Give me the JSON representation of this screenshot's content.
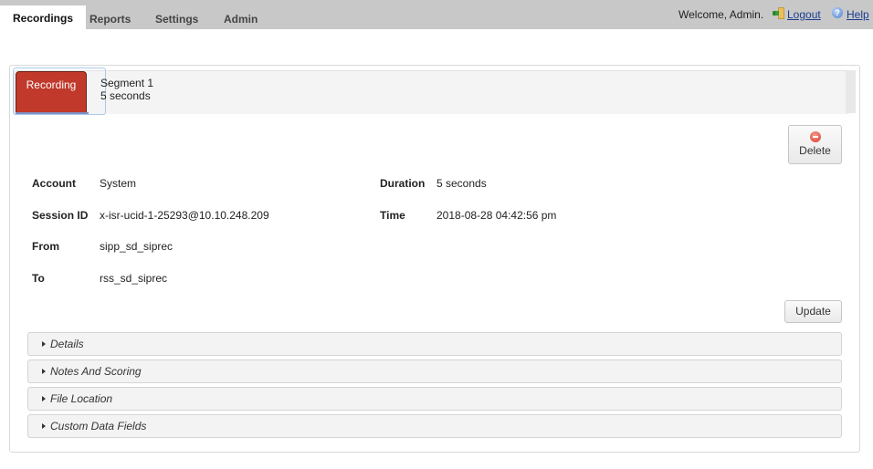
{
  "nav": {
    "tabs": [
      {
        "label": "Recordings",
        "active": true
      },
      {
        "label": "Reports",
        "active": false
      },
      {
        "label": "Settings",
        "active": false
      },
      {
        "label": "Admin",
        "active": false
      }
    ],
    "welcome": "Welcome, Admin.",
    "logout": "Logout",
    "help": "Help",
    "help_glyph": "?"
  },
  "recording": {
    "tabs": {
      "recording_label": "Recording",
      "segment_title": "Segment 1",
      "segment_duration": "5 seconds"
    },
    "delete_label": "Delete",
    "update_label": "Update",
    "fields": {
      "account": {
        "label": "Account",
        "value": "System"
      },
      "session_id": {
        "label": "Session ID",
        "value": "x-isr-ucid-1-25293@10.10.248.209"
      },
      "from": {
        "label": "From",
        "value": "sipp_sd_siprec"
      },
      "to": {
        "label": "To",
        "value": "rss_sd_siprec"
      },
      "duration": {
        "label": "Duration",
        "value": "5 seconds"
      },
      "time": {
        "label": "Time",
        "value": "2018-08-28 04:42:56 pm"
      }
    },
    "sections": [
      "Details",
      "Notes And Scoring",
      "File Location",
      "Custom Data Fields"
    ]
  },
  "colors": {
    "accent_red": "#c0392b",
    "topbar": "#c8c8c8",
    "link": "#1a3d8f"
  }
}
